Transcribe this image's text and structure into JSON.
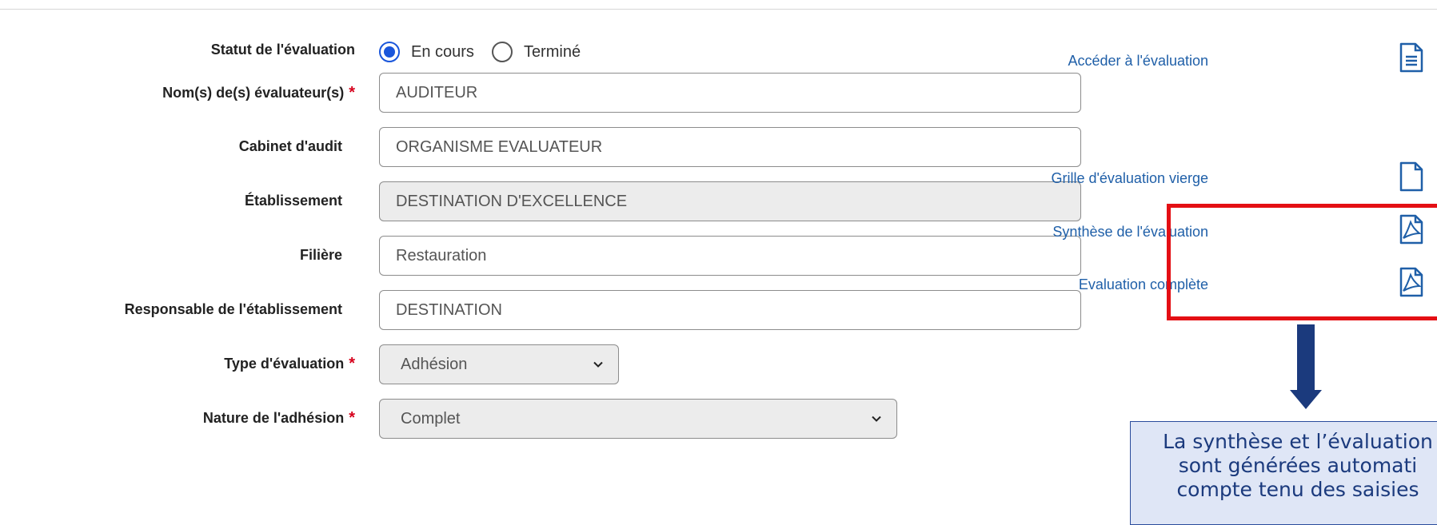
{
  "form": {
    "status": {
      "label": "Statut de l'évaluation",
      "options": [
        "En cours",
        "Terminé"
      ],
      "selected": "En cours"
    },
    "evaluators": {
      "label": "Nom(s) de(s) évaluateur(s)",
      "required_mark": "*",
      "value": "AUDITEUR"
    },
    "audit_firm": {
      "label": "Cabinet d'audit",
      "value": "ORGANISME EVALUATEUR"
    },
    "establishment": {
      "label": "Établissement",
      "value": "DESTINATION D'EXCELLENCE"
    },
    "sector": {
      "label": "Filière",
      "value": "Restauration"
    },
    "manager": {
      "label": "Responsable de l'établissement",
      "value": "DESTINATION"
    },
    "eval_type": {
      "label": "Type d'évaluation",
      "required_mark": "*",
      "value": "Adhésion"
    },
    "membership_nature": {
      "label": "Nature de l'adhésion",
      "required_mark": "*",
      "value": "Complet"
    }
  },
  "links": {
    "access": "Accéder à l'évaluation",
    "blank_grid": "Grille d'évaluation vierge",
    "synthesis": "Synthèse de l'évaluation",
    "complete": "Evaluation complète"
  },
  "annotation": {
    "lines": [
      "La synthèse et l’évaluation",
      "sont générées automati",
      "compte tenu des saisies"
    ],
    "box_color": "#e40f14",
    "arrow_color": "#1b3a7d"
  },
  "colors": {
    "link": "#1f5fa8",
    "required": "#d6001c",
    "radio_accent": "#1a56db"
  }
}
